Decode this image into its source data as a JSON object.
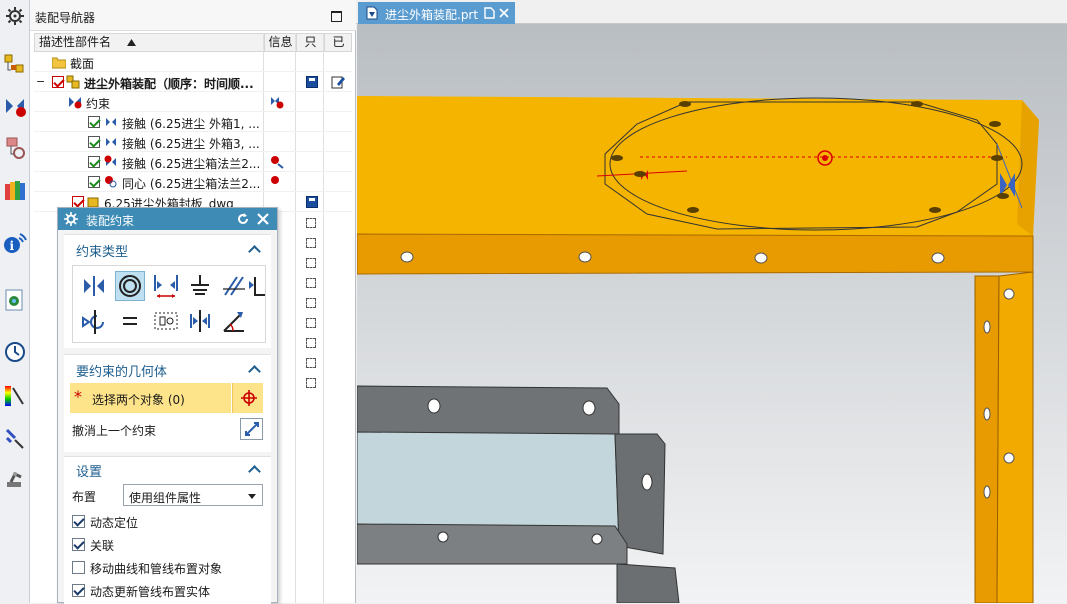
{
  "navigator": {
    "title": "装配导航器",
    "columns": {
      "name": "描述性部件名",
      "info": "信息",
      "col3": "只",
      "col4": "已"
    },
    "items": [
      {
        "label": "截面"
      },
      {
        "label": "进尘外箱装配（顺序：时间顺..."
      },
      {
        "label": "约束"
      },
      {
        "label": "接触 (6.25进尘 外箱1, ..."
      },
      {
        "label": "接触 (6.25进尘 外箱3, ..."
      },
      {
        "label": "接触 (6.25进尘箱法兰2..."
      },
      {
        "label": "同心 (6.25进尘箱法兰2..."
      },
      {
        "label": "6.25进尘外箱封板_dwg"
      }
    ]
  },
  "dialog": {
    "title": "装配约束",
    "section_type": "约束类型",
    "section_geometry": "要约束的几何体",
    "select_label": "选择两个对象 (0)",
    "undo_label": "撤消上一个约束",
    "section_settings": "设置",
    "layout_label": "布置",
    "layout_value": "使用组件属性",
    "options": [
      {
        "label": "动态定位",
        "checked": true
      },
      {
        "label": "关联",
        "checked": true
      },
      {
        "label": "移动曲线和管线布置对象",
        "checked": false
      },
      {
        "label": "动态更新管线布置实体",
        "checked": true
      }
    ],
    "constraint_tools": [
      "touch-align-icon",
      "concentric-icon",
      "distance-icon",
      "fix-icon",
      "parallel-icon",
      "perpendicular-icon",
      "align-lock-icon",
      "equal-icon",
      "fit-icon",
      "center-icon",
      "angle-icon"
    ]
  },
  "tab": {
    "label": "进尘外箱装配.prt"
  },
  "colors": {
    "accent": "#3e8bb6",
    "part_orange": "#f5b400",
    "part_gray": "#7c8083",
    "highlight": "#fde38a"
  }
}
